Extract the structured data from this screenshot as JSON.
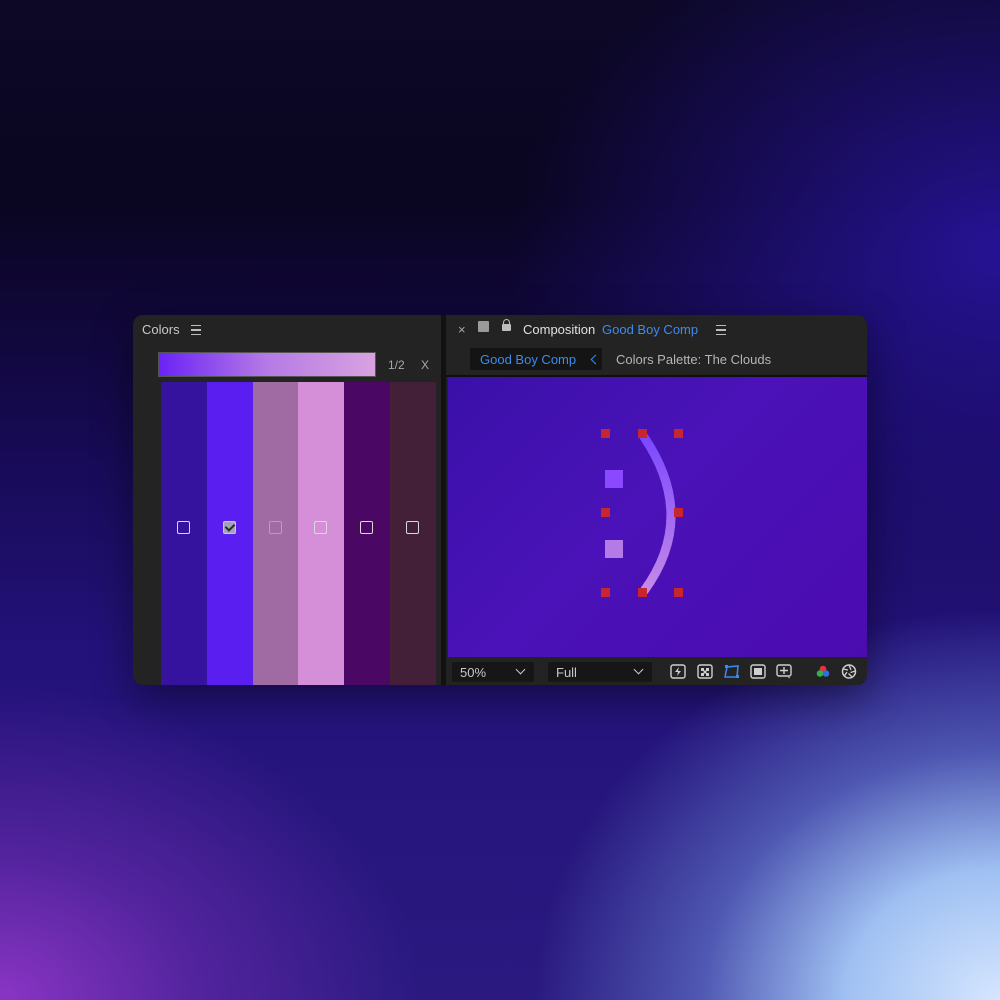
{
  "colors_panel": {
    "title": "Colors",
    "palette_page": "1/2",
    "palette_close": "X",
    "swatches": [
      {
        "color": "#36139e",
        "checked": false
      },
      {
        "color": "#5b1ef0",
        "checked": true
      },
      {
        "color": "#a06aa3",
        "checked": false
      },
      {
        "color": "#d48fd8",
        "checked": false
      },
      {
        "color": "#4a0763",
        "checked": false
      },
      {
        "color": "#442038",
        "checked": false
      }
    ],
    "palette_gradient": [
      "#6a23f5",
      "#b57ae6",
      "#d9a2df"
    ]
  },
  "composition_panel": {
    "close": "×",
    "label": "Composition",
    "comp_name": "Good Boy Comp",
    "tabs": {
      "active": "Good Boy Comp",
      "inactive": "Colors Palette: The Clouds"
    },
    "toolbar": {
      "zoom": "50%",
      "resolution": "Full"
    }
  },
  "colors": {
    "accent_blue": "#3d8bf0",
    "handle_red": "#c8262f"
  }
}
